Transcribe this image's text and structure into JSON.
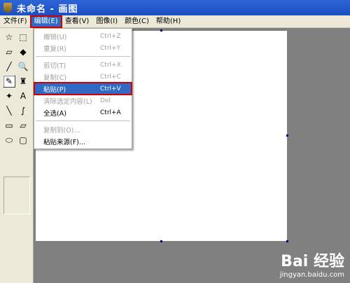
{
  "window": {
    "title": "未命名 - 画图"
  },
  "menubar": [
    {
      "label": "文件(F)"
    },
    {
      "label": "编辑(E)",
      "active": true
    },
    {
      "label": "查看(V)"
    },
    {
      "label": "图像(I)"
    },
    {
      "label": "颜色(C)"
    },
    {
      "label": "帮助(H)"
    }
  ],
  "tools": [
    {
      "name": "free-select-icon",
      "glyph": "☆"
    },
    {
      "name": "rect-select-icon",
      "glyph": "⬚"
    },
    {
      "name": "eraser-icon",
      "glyph": "▱"
    },
    {
      "name": "fill-icon",
      "glyph": "◆"
    },
    {
      "name": "color-picker-icon",
      "glyph": "╱"
    },
    {
      "name": "magnifier-icon",
      "glyph": "🔍"
    },
    {
      "name": "pencil-icon",
      "glyph": "✎",
      "selected": true
    },
    {
      "name": "brush-icon",
      "glyph": "♜"
    },
    {
      "name": "airbrush-icon",
      "glyph": "✦"
    },
    {
      "name": "text-icon",
      "glyph": "A"
    },
    {
      "name": "line-icon",
      "glyph": "╲"
    },
    {
      "name": "curve-icon",
      "glyph": "∫"
    },
    {
      "name": "rectangle-icon",
      "glyph": "▭"
    },
    {
      "name": "polygon-icon",
      "glyph": "▱"
    },
    {
      "name": "ellipse-icon",
      "glyph": "⬭"
    },
    {
      "name": "rounded-rect-icon",
      "glyph": "▢"
    }
  ],
  "edit_menu": {
    "items": [
      {
        "label": "撤销(U)",
        "shortcut": "Ctrl+Z",
        "disabled": true
      },
      {
        "label": "重复(R)",
        "shortcut": "Ctrl+Y",
        "disabled": true
      },
      {
        "separator": true
      },
      {
        "label": "剪切(T)",
        "shortcut": "Ctrl+X",
        "disabled": true
      },
      {
        "label": "复制(C)",
        "shortcut": "Ctrl+C",
        "disabled": true
      },
      {
        "label": "粘贴(P)",
        "shortcut": "Ctrl+V",
        "disabled": false,
        "highlight": true
      },
      {
        "label": "清除选定内容(L)",
        "shortcut": "Del",
        "disabled": true
      },
      {
        "label": "全选(A)",
        "shortcut": "Ctrl+A",
        "disabled": false
      },
      {
        "separator": true
      },
      {
        "label": "复制到(O)...",
        "shortcut": "",
        "disabled": true
      },
      {
        "label": "粘贴来源(F)...",
        "shortcut": "",
        "disabled": false
      }
    ]
  },
  "watermark": {
    "logo": "Bai 经验",
    "url": "jingyan.baidu.com"
  },
  "colors": {
    "titlebar": "#1d4fc2",
    "highlight": "#316ac5",
    "annotation": "#d00000"
  }
}
